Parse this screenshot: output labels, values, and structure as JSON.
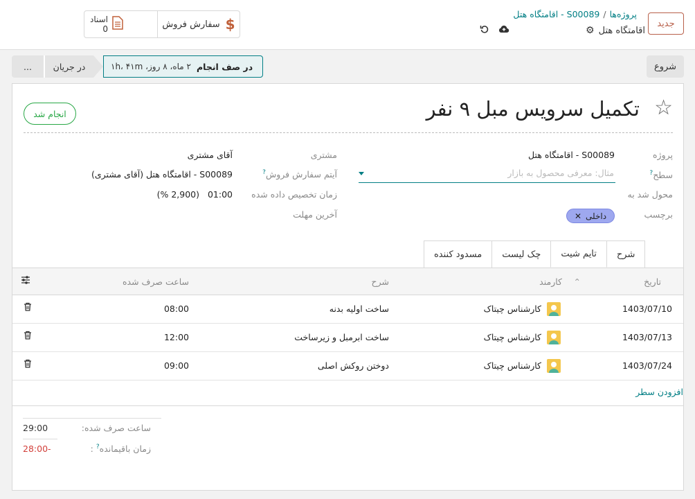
{
  "control_panel": {
    "new_button": "جدید",
    "breadcrumb_parent": "پروژه‌ها",
    "breadcrumb_separator": "/",
    "breadcrumb_current": "S00089 - اقامتگاه هتل",
    "record_name": "اقامتگاه هتل",
    "smart_buttons": {
      "sales_order": "سفارش فروش",
      "documents_label": "اسناد",
      "documents_count": "0"
    }
  },
  "status_bar": {
    "start_button": "شروع",
    "stages": {
      "more": "...",
      "in_progress": "در جریان",
      "current": "در صف انجام",
      "current_duration": "۲ ماه، ۸ روز، ۱h، ۴۱m"
    }
  },
  "task": {
    "title": "تکمیل سرویس مبل ۹ نفر",
    "done_button": "انجام شد",
    "fields": {
      "project_label": "پروژه",
      "project_value": "S00089 - اقامتگاه هتل",
      "level_label": "سطح",
      "level_placeholder": "مثال: معرفی محصول به بازار",
      "assigned_label": "محول شد به",
      "tags_label": "برچسب",
      "tag_value": "داخلی",
      "customer_label": "مشتری",
      "customer_value": "آقای مشتری",
      "so_item_label": "آیتم سفارش فروش",
      "so_item_value": "S00089 - اقامتگاه هتل (آقای مشتری)",
      "allocated_label": "زمان تخصیص داده شده",
      "allocated_value": "01:00",
      "allocated_percent": "(2,900 %)",
      "deadline_label": "آخرین مهلت"
    }
  },
  "tabs": [
    "شرح",
    "تایم شیت",
    "چک لیست",
    "مسدود کننده"
  ],
  "timesheet": {
    "columns": {
      "date": "تاریخ",
      "employee": "کارمند",
      "description": "شرح",
      "hours": "ساعت صرف شده"
    },
    "rows": [
      {
        "date": "1403/07/10",
        "employee": "کارشناس چیتاک",
        "description": "ساخت اولیه بدنه",
        "hours": "08:00"
      },
      {
        "date": "1403/07/13",
        "employee": "کارشناس چیتاک",
        "description": "ساخت ابرمبل و زیرساخت",
        "hours": "12:00"
      },
      {
        "date": "1403/07/24",
        "employee": "کارشناس چیتاک",
        "description": "دوختن روکش اصلی",
        "hours": "09:00"
      }
    ],
    "add_line": "افزودن سطر",
    "totals": {
      "spent_label": "ساعت صرف شده:",
      "spent_value": "29:00",
      "remaining_label": "زمان باقیمانده",
      "remaining_value": "-28:00"
    }
  },
  "colors": {
    "accent": "#017e84",
    "primary": "#b8604a",
    "success": "#28a745",
    "danger": "#d23f3a",
    "tag": "#9ea8ef"
  }
}
